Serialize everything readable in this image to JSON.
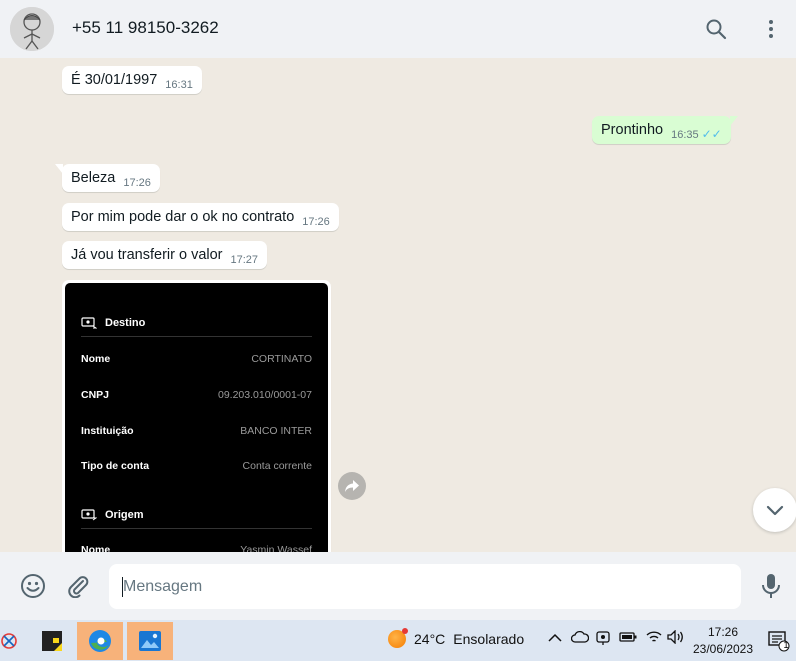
{
  "header": {
    "contact": "+55 11 98150-3262"
  },
  "messages": [
    {
      "text": "É 30/01/1997",
      "time": "16:31",
      "dir": "in"
    },
    {
      "text": "Prontinho",
      "time": "16:35",
      "dir": "out"
    },
    {
      "text": "Beleza",
      "time": "17:26",
      "dir": "in"
    },
    {
      "text": "Por mim pode dar o ok no contrato",
      "time": "17:26",
      "dir": "in"
    },
    {
      "text": "Já vou transferir o valor",
      "time": "17:27",
      "dir": "in"
    }
  ],
  "receipt": {
    "destino_label": "Destino",
    "rows": [
      {
        "k": "Nome",
        "v": "CORTINATO"
      },
      {
        "k": "CNPJ",
        "v": "09.203.010/0001-07"
      },
      {
        "k": "Instituição",
        "v": "BANCO INTER"
      },
      {
        "k": "Tipo de conta",
        "v": "Conta corrente"
      }
    ],
    "origem_label": "Origem",
    "origem_rows": [
      {
        "k": "Nome",
        "v": "Yasmin Wassef"
      }
    ]
  },
  "composer": {
    "placeholder": "Mensagem"
  },
  "taskbar": {
    "temperature": "24°C",
    "weather": "Ensolarado",
    "time": "17:26",
    "date": "23/06/2023",
    "notification_count": "1"
  },
  "colors": {
    "header_bg": "#f0f2f5",
    "chat_bg": "#efeae2",
    "outgoing_bubble": "#d9fdd3",
    "incoming_bubble": "#ffffff",
    "read_ticks": "#53bdeb"
  }
}
